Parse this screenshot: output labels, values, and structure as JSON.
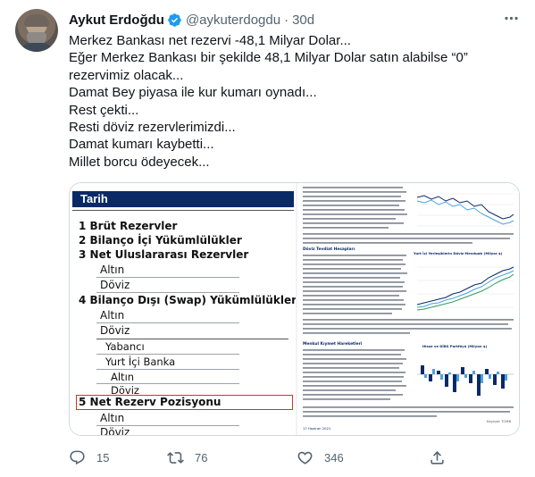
{
  "tweet": {
    "author_name": "Aykut Erdoğdu",
    "handle": "@aykuterdogdu",
    "separator": "·",
    "time": "30d",
    "lines": [
      "Merkez Bankası net rezervi -48,1 Milyar Dolar...",
      "Eğer Merkez Bankası bir şekilde 48,1 Milyar Dolar satın alabilse “0”",
      "rezervimiz olacak...",
      "Damat Bey piyasa ile kur kumarı oynadı...",
      "Rest çekti...",
      "Resti döviz rezervlerimizdi...",
      "Damat kumarı kaybetti...",
      "Millet borcu ödeyecek..."
    ]
  },
  "media": {
    "left": {
      "header": "Tarih",
      "rows": [
        "1 Brüt Rezervler",
        "2 Bilanço İçi Yükümlülükler",
        "3 Net Uluslararası Rezervler",
        "Altın",
        "Döviz",
        "4 Bilanço Dışı (Swap) Yükümlülükleri",
        "Altın",
        "Döviz",
        "Yabancı",
        "Yurt İçi Banka",
        "Altın",
        "Döviz",
        "5 Net Rezerv Pozisyonu",
        "Altın",
        "Döviz"
      ]
    },
    "right": {
      "section_titles": [
        "Döviz Tevdiat Hesapları",
        "Menkul Kıymet Hareketleri"
      ],
      "chart_titles": [
        "Yurt İçi Yerleşiklerin Döviz Mevduatı (Milyar $)",
        "Hisse ve DİBS Portföyü (Milyon $)"
      ],
      "footer_left": "17 Haziran 2021",
      "footer_right": "Kaynak: TCMB"
    }
  },
  "actions": {
    "replies": "15",
    "retweets": "76",
    "likes": "346"
  },
  "colors": {
    "accent": "#1d9bf0",
    "muted": "#536471",
    "tarih_bg": "#0a2a66",
    "highlight_border": "#d8312a"
  }
}
